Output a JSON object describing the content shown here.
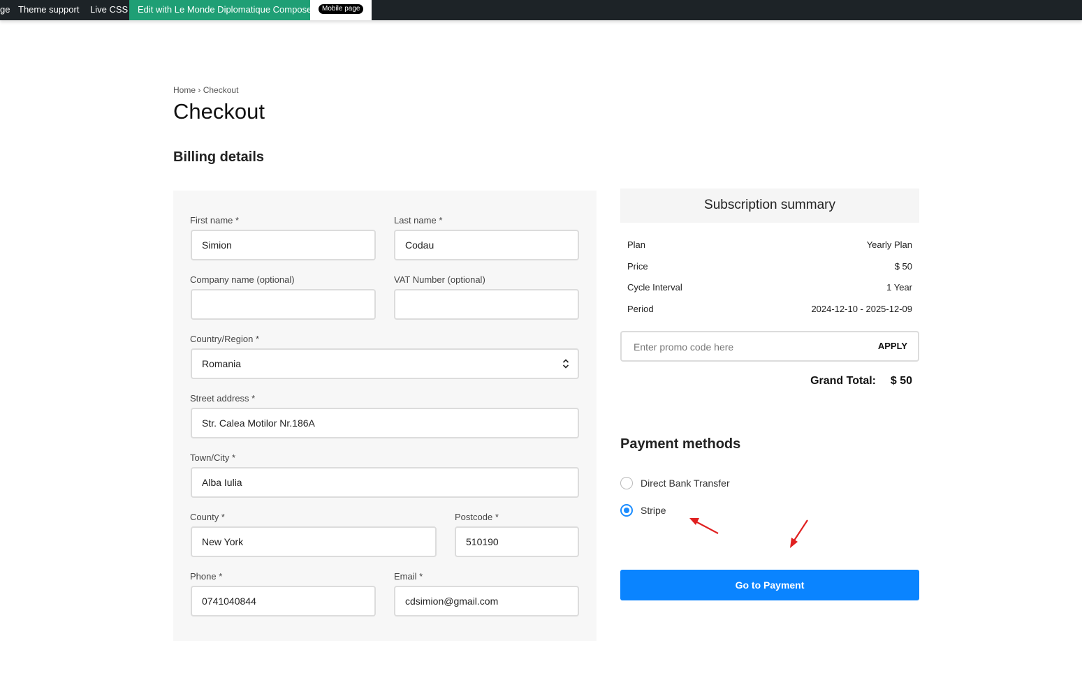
{
  "adminbar": {
    "item_page": "ge",
    "item_theme": "Theme support",
    "item_css": "Live CSS",
    "item_composer": "Edit with Le Monde Diplomatique Composer",
    "item_mobile": "Mobile page"
  },
  "breadcrumb": {
    "home": "Home",
    "sep": "›",
    "current": "Checkout"
  },
  "page_title": "Checkout",
  "billing": {
    "title": "Billing details",
    "first_name": {
      "label": "First name *",
      "value": "Simion"
    },
    "last_name": {
      "label": "Last name *",
      "value": "Codau"
    },
    "company": {
      "label": "Company name (optional)",
      "value": ""
    },
    "vat": {
      "label": "VAT Number (optional)",
      "value": ""
    },
    "country": {
      "label": "Country/Region *",
      "value": "Romania"
    },
    "street": {
      "label": "Street address *",
      "value": "Str. Calea Motilor Nr.186A"
    },
    "town": {
      "label": "Town/City *",
      "value": "Alba Iulia"
    },
    "county": {
      "label": "County *",
      "value": "New York"
    },
    "postcode": {
      "label": "Postcode *",
      "value": "510190"
    },
    "phone": {
      "label": "Phone *",
      "value": "0741040844"
    },
    "email": {
      "label": "Email *",
      "value": "cdsimion@gmail.com"
    }
  },
  "summary": {
    "title": "Subscription summary",
    "rows": [
      {
        "key": "Plan",
        "value": "Yearly Plan"
      },
      {
        "key": "Price",
        "value": "$ 50"
      },
      {
        "key": "Cycle Interval",
        "value": "1 Year"
      },
      {
        "key": "Period",
        "value": "2024-12-10 - 2025-12-09"
      }
    ],
    "promo_placeholder": "Enter promo code here",
    "apply": "APPLY",
    "grand_total_label": "Grand Total:",
    "grand_total_value": "$ 50"
  },
  "payment": {
    "title": "Payment methods",
    "methods": [
      {
        "label": "Direct Bank Transfer",
        "selected": false
      },
      {
        "label": "Stripe",
        "selected": true
      }
    ],
    "button": "Go to Payment"
  },
  "colors": {
    "adminbar": "#1d2327",
    "composer": "#1f9f75",
    "accent": "#0a84ff",
    "annotation": "#e02020"
  }
}
